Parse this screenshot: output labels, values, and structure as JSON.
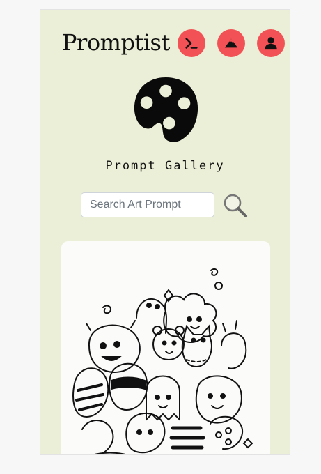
{
  "app": {
    "brand": "Promptist"
  },
  "nav": [
    {
      "icon": "terminal-icon"
    },
    {
      "icon": "mountain-icon"
    },
    {
      "icon": "user-icon"
    }
  ],
  "hero": {
    "icon": "palette-icon",
    "title": "Prompt Gallery"
  },
  "search": {
    "placeholder": "Search Art Prompt",
    "value": "",
    "icon": "magnifier-icon"
  },
  "gallery": {
    "items": [
      {
        "kind": "image",
        "subject": "doodle drawing"
      }
    ]
  },
  "colors": {
    "background": "#ecefd7",
    "accent": "#f25256",
    "page": "#f7f7f7"
  }
}
